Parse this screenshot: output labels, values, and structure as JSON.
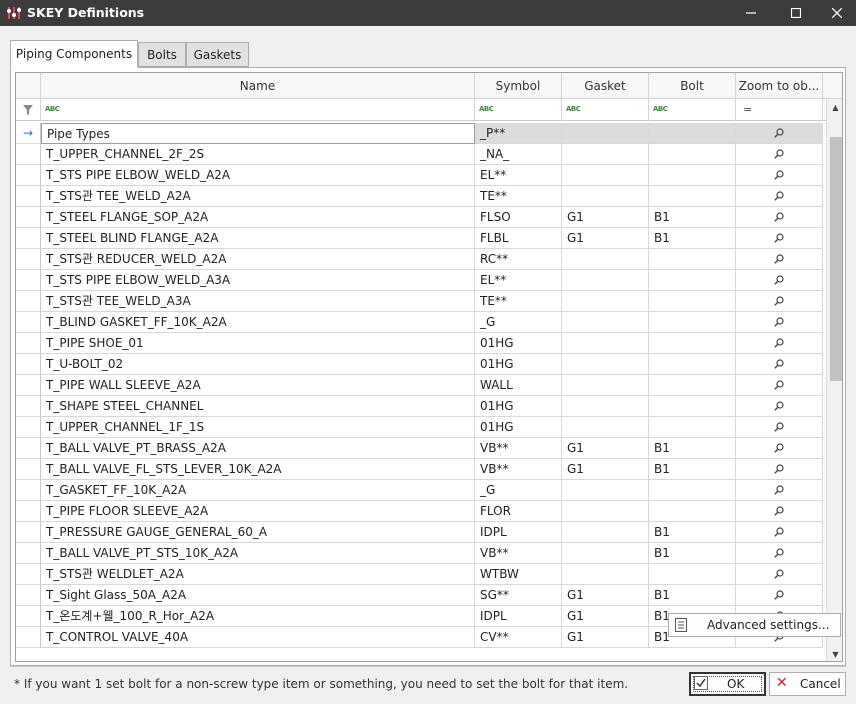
{
  "window": {
    "title": "SKEY Definitions"
  },
  "tabs": [
    {
      "label": "Piping Components",
      "active": true
    },
    {
      "label": "Bolts",
      "active": false
    },
    {
      "label": "Gaskets",
      "active": false
    }
  ],
  "grid": {
    "columns": [
      "Name",
      "Symbol",
      "Gasket",
      "Bolt",
      "Zoom to ob..."
    ],
    "filter_icons": [
      "filter-icon",
      "text-filter-icon",
      "text-filter-icon",
      "text-filter-icon",
      "text-filter-icon",
      "equals-filter-icon"
    ],
    "focused_row": 0,
    "rows": [
      {
        "name": "Pipe Types",
        "symbol": "_P**",
        "gasket": "",
        "bolt": ""
      },
      {
        "name": "T_UPPER_CHANNEL_2F_2S",
        "symbol": "_NA_",
        "gasket": "",
        "bolt": ""
      },
      {
        "name": "T_STS PIPE ELBOW_WELD_A2A",
        "symbol": "EL**",
        "gasket": "",
        "bolt": ""
      },
      {
        "name": "T_STS관 TEE_WELD_A2A",
        "symbol": "TE**",
        "gasket": "",
        "bolt": ""
      },
      {
        "name": "T_STEEL FLANGE_SOP_A2A",
        "symbol": "FLSO",
        "gasket": "G1",
        "bolt": "B1"
      },
      {
        "name": "T_STEEL BLIND FLANGE_A2A",
        "symbol": "FLBL",
        "gasket": "G1",
        "bolt": "B1"
      },
      {
        "name": "T_STS관 REDUCER_WELD_A2A",
        "symbol": "RC**",
        "gasket": "",
        "bolt": ""
      },
      {
        "name": "T_STS PIPE ELBOW_WELD_A3A",
        "symbol": "EL**",
        "gasket": "",
        "bolt": ""
      },
      {
        "name": "T_STS관 TEE_WELD_A3A",
        "symbol": "TE**",
        "gasket": "",
        "bolt": ""
      },
      {
        "name": "T_BLIND GASKET_FF_10K_A2A",
        "symbol": "_G",
        "gasket": "",
        "bolt": ""
      },
      {
        "name": "T_PIPE SHOE_01",
        "symbol": "01HG",
        "gasket": "",
        "bolt": ""
      },
      {
        "name": "T_U-BOLT_02",
        "symbol": "01HG",
        "gasket": "",
        "bolt": ""
      },
      {
        "name": "T_PIPE WALL SLEEVE_A2A",
        "symbol": "WALL",
        "gasket": "",
        "bolt": ""
      },
      {
        "name": "T_SHAPE STEEL_CHANNEL",
        "symbol": "01HG",
        "gasket": "",
        "bolt": ""
      },
      {
        "name": "T_UPPER_CHANNEL_1F_1S",
        "symbol": "01HG",
        "gasket": "",
        "bolt": ""
      },
      {
        "name": "T_BALL VALVE_PT_BRASS_A2A",
        "symbol": "VB**",
        "gasket": "G1",
        "bolt": "B1"
      },
      {
        "name": "T_BALL VALVE_FL_STS_LEVER_10K_A2A",
        "symbol": "VB**",
        "gasket": "G1",
        "bolt": "B1"
      },
      {
        "name": "T_GASKET_FF_10K_A2A",
        "symbol": "_G",
        "gasket": "",
        "bolt": ""
      },
      {
        "name": "T_PIPE FLOOR SLEEVE_A2A",
        "symbol": "FLOR",
        "gasket": "",
        "bolt": ""
      },
      {
        "name": "T_PRESSURE GAUGE_GENERAL_60_A",
        "symbol": "IDPL",
        "gasket": "",
        "bolt": "B1"
      },
      {
        "name": "T_BALL VALVE_PT_STS_10K_A2A",
        "symbol": "VB**",
        "gasket": "",
        "bolt": "B1"
      },
      {
        "name": "T_STS관 WELDLET_A2A",
        "symbol": "WTBW",
        "gasket": "",
        "bolt": ""
      },
      {
        "name": "T_Sight Glass_50A_A2A",
        "symbol": "SG**",
        "gasket": "G1",
        "bolt": "B1"
      },
      {
        "name": "T_온도계+웰_100_R_Hor_A2A",
        "symbol": "IDPL",
        "gasket": "G1",
        "bolt": "B1"
      },
      {
        "name": "T_CONTROL VALVE_40A",
        "symbol": "CV**",
        "gasket": "G1",
        "bolt": "B1"
      }
    ]
  },
  "buttons": {
    "advanced": "Advanced settings...",
    "ok": "OK",
    "cancel": "Cancel"
  },
  "footer_note": "* If you want 1 set bolt for a non-screw type item or something, you need to set the bolt for that item.",
  "colors": {
    "titlebar": "#3c3c3c",
    "accent": "#2a6fd6",
    "cancel_x": "#d02020"
  }
}
